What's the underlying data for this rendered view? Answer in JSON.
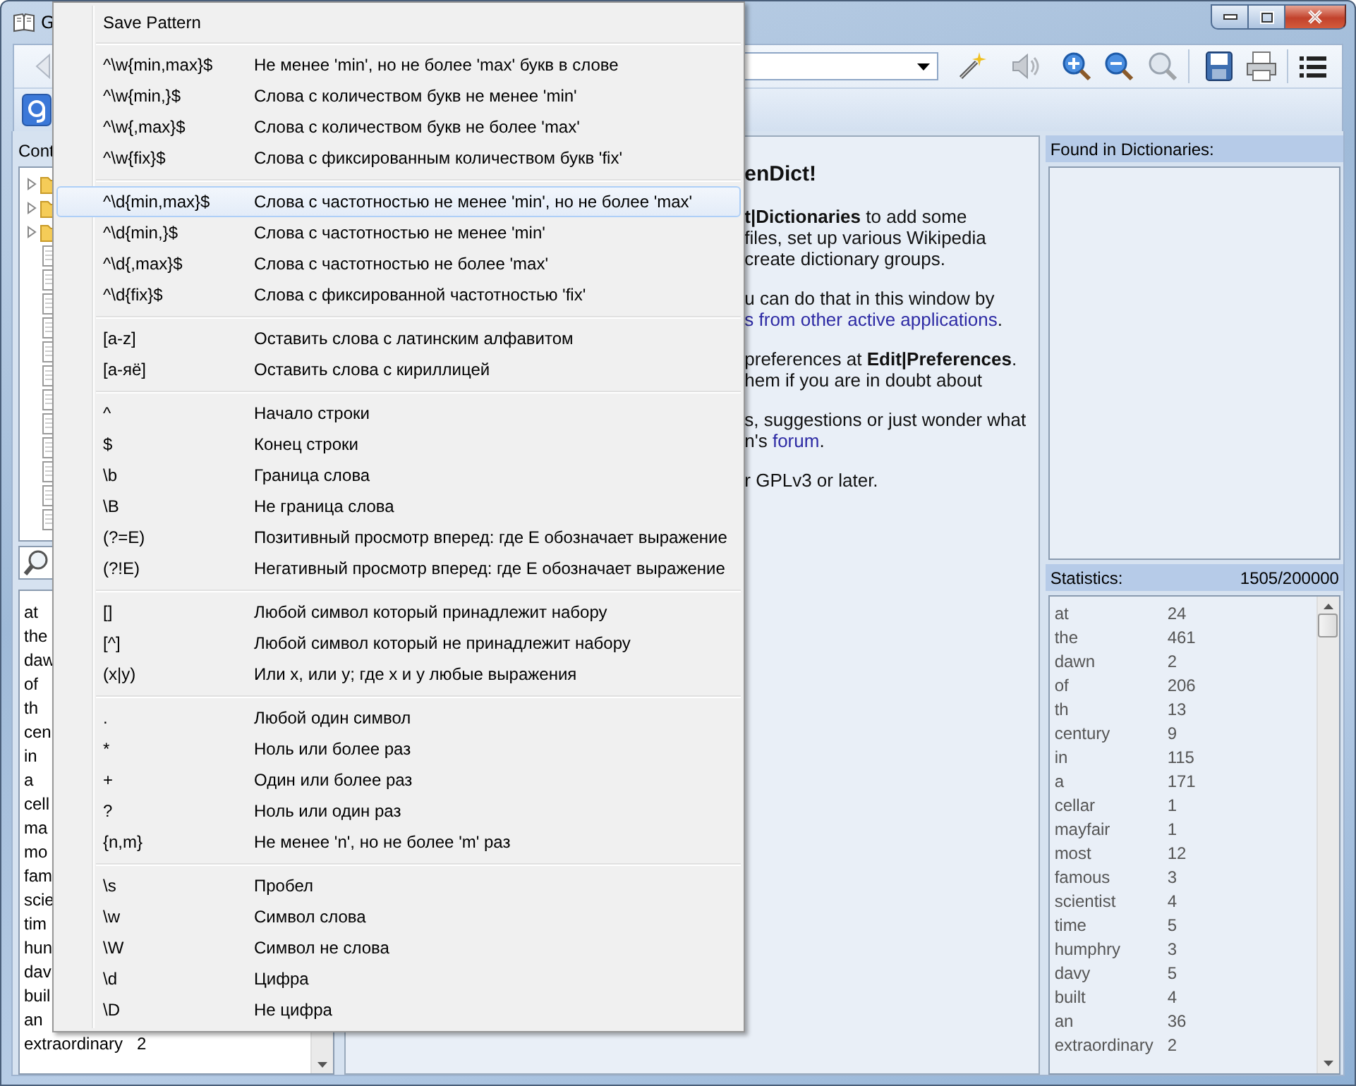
{
  "window": {
    "title": "G"
  },
  "left_panel": {
    "header": "Cont",
    "tree": [
      {
        "kind": "folder",
        "expanded": false
      },
      {
        "kind": "folder",
        "expanded": false
      },
      {
        "kind": "folder",
        "expanded": false
      },
      {
        "kind": "page"
      },
      {
        "kind": "page"
      },
      {
        "kind": "page"
      },
      {
        "kind": "page"
      },
      {
        "kind": "page"
      },
      {
        "kind": "page"
      },
      {
        "kind": "page"
      },
      {
        "kind": "page"
      },
      {
        "kind": "page"
      },
      {
        "kind": "page"
      },
      {
        "kind": "page"
      },
      {
        "kind": "page"
      }
    ],
    "words": [
      {
        "word": "at"
      },
      {
        "word": "the"
      },
      {
        "word": "daw"
      },
      {
        "word": "of"
      },
      {
        "word": "th"
      },
      {
        "word": "cen"
      },
      {
        "word": "in"
      },
      {
        "word": "a"
      },
      {
        "word": "cell"
      },
      {
        "word": "ma"
      },
      {
        "word": "mo"
      },
      {
        "word": "fam"
      },
      {
        "word": "scie"
      },
      {
        "word": "tim"
      },
      {
        "word": "hun"
      },
      {
        "word": "dav"
      },
      {
        "word": "buil"
      },
      {
        "word": "an"
      },
      {
        "word": "extraordinary",
        "count": "2"
      }
    ]
  },
  "article": {
    "heading": "enDict!",
    "paragraphs": [
      [
        [
          {
            "kind": "bold",
            "text": "t|Dictionaries"
          },
          {
            "kind": "plain",
            "text": " to add some"
          }
        ],
        [
          {
            "kind": "plain",
            "text": "files, set up various Wikipedia"
          }
        ],
        [
          {
            "kind": "plain",
            "text": "create dictionary groups."
          }
        ]
      ],
      [
        [
          {
            "kind": "plain",
            "text": "u can do that in this window by"
          }
        ],
        [
          {
            "kind": "link",
            "text": "s from other active applications"
          },
          {
            "kind": "plain",
            "text": "."
          }
        ]
      ],
      [
        [
          {
            "kind": "plain",
            "text": "preferences at "
          },
          {
            "kind": "bold",
            "text": "Edit|Preferences"
          },
          {
            "kind": "plain",
            "text": "."
          }
        ],
        [
          {
            "kind": "plain",
            "text": "hem if you are in doubt about"
          }
        ]
      ],
      [
        [
          {
            "kind": "plain",
            "text": "s, suggestions or just wonder what"
          }
        ],
        [
          {
            "kind": "plain",
            "text": "n's "
          },
          {
            "kind": "link",
            "text": "forum"
          },
          {
            "kind": "plain",
            "text": "."
          }
        ]
      ],
      [
        [
          {
            "kind": "plain",
            "text": "r GPLv3 or later."
          }
        ]
      ]
    ]
  },
  "right_panel": {
    "found_header": "Found in Dictionaries:",
    "stats_header": "Statistics:",
    "stats_total": "1505/200000",
    "stats": [
      {
        "word": "at",
        "count": "24"
      },
      {
        "word": "the",
        "count": "461"
      },
      {
        "word": "dawn",
        "count": "2"
      },
      {
        "word": "of",
        "count": "206"
      },
      {
        "word": "th",
        "count": "13"
      },
      {
        "word": "century",
        "count": "9"
      },
      {
        "word": "in",
        "count": "115"
      },
      {
        "word": "a",
        "count": "171"
      },
      {
        "word": "cellar",
        "count": "1"
      },
      {
        "word": "mayfair",
        "count": "1"
      },
      {
        "word": "most",
        "count": "12"
      },
      {
        "word": "famous",
        "count": "3"
      },
      {
        "word": "scientist",
        "count": "4"
      },
      {
        "word": "time",
        "count": "5"
      },
      {
        "word": "humphry",
        "count": "3"
      },
      {
        "word": "davy",
        "count": "5"
      },
      {
        "word": "built",
        "count": "4"
      },
      {
        "word": "an",
        "count": "36"
      },
      {
        "word": "extraordinary",
        "count": "2"
      }
    ]
  },
  "menu": {
    "items": [
      {
        "kind": "action",
        "label": "Save Pattern"
      },
      {
        "kind": "separator"
      },
      {
        "kind": "pattern",
        "pattern": "^\\w{min,max}$",
        "description": "Не менее 'min', но не более 'max' букв в слове",
        "selected": false
      },
      {
        "kind": "pattern",
        "pattern": "^\\w{min,}$",
        "description": "Слова с количеством букв не менее 'min'",
        "selected": false
      },
      {
        "kind": "pattern",
        "pattern": "^\\w{,max}$",
        "description": "Слова с количеством букв не более 'max'",
        "selected": false
      },
      {
        "kind": "pattern",
        "pattern": "^\\w{fix}$",
        "description": "Слова с фиксированным количеством букв 'fix'",
        "selected": false
      },
      {
        "kind": "separator"
      },
      {
        "kind": "pattern",
        "pattern": "^\\d{min,max}$",
        "description": "Слова с частотностью не менее 'min', но не более 'max'",
        "selected": true
      },
      {
        "kind": "pattern",
        "pattern": "^\\d{min,}$",
        "description": "Слова с частотностью не менее 'min'",
        "selected": false
      },
      {
        "kind": "pattern",
        "pattern": "^\\d{,max}$",
        "description": "Слова с частотностью не более 'max'",
        "selected": false
      },
      {
        "kind": "pattern",
        "pattern": "^\\d{fix}$",
        "description": "Слова с фиксированной частотностью 'fix'",
        "selected": false
      },
      {
        "kind": "separator"
      },
      {
        "kind": "pattern",
        "pattern": "[a-z]",
        "description": "Оставить слова с латинским алфавитом",
        "selected": false
      },
      {
        "kind": "pattern",
        "pattern": "[a-яё]",
        "description": "Оставить слова с кириллицей",
        "selected": false
      },
      {
        "kind": "separator"
      },
      {
        "kind": "pattern",
        "pattern": "^",
        "description": "Начало строки",
        "selected": false
      },
      {
        "kind": "pattern",
        "pattern": "$",
        "description": "Конец строки",
        "selected": false
      },
      {
        "kind": "pattern",
        "pattern": "\\b",
        "description": "Граница слова",
        "selected": false
      },
      {
        "kind": "pattern",
        "pattern": "\\B",
        "description": "Не граница слова",
        "selected": false
      },
      {
        "kind": "pattern",
        "pattern": "(?=E)",
        "description": "Позитивный просмотр вперед: где E обозначает выражение",
        "selected": false
      },
      {
        "kind": "pattern",
        "pattern": "(?!E)",
        "description": "Негативный просмотр вперед: где E обозначает выражение",
        "selected": false
      },
      {
        "kind": "separator"
      },
      {
        "kind": "pattern",
        "pattern": "[]",
        "description": "Любой символ который принадлежит набору",
        "selected": false
      },
      {
        "kind": "pattern",
        "pattern": "[^]",
        "description": "Любой символ который не принадлежит набору",
        "selected": false
      },
      {
        "kind": "pattern",
        "pattern": "(x|y)",
        "description": "Или x, или y; где x и y  любые выражения",
        "selected": false
      },
      {
        "kind": "separator"
      },
      {
        "kind": "pattern",
        "pattern": ".",
        "description": "Любой один символ",
        "selected": false
      },
      {
        "kind": "pattern",
        "pattern": "*",
        "description": "Ноль или более раз",
        "selected": false
      },
      {
        "kind": "pattern",
        "pattern": "+",
        "description": "Один или более раз",
        "selected": false
      },
      {
        "kind": "pattern",
        "pattern": "?",
        "description": "Ноль или один раз",
        "selected": false
      },
      {
        "kind": "pattern",
        "pattern": "{n,m}",
        "description": "Не менее 'n', но не более 'm' раз",
        "selected": false
      },
      {
        "kind": "separator"
      },
      {
        "kind": "pattern",
        "pattern": "\\s",
        "description": "Пробел",
        "selected": false
      },
      {
        "kind": "pattern",
        "pattern": "\\w",
        "description": "Символ слова",
        "selected": false
      },
      {
        "kind": "pattern",
        "pattern": "\\W",
        "description": "Символ не слова",
        "selected": false
      },
      {
        "kind": "pattern",
        "pattern": "\\d",
        "description": "Цифра",
        "selected": false
      },
      {
        "kind": "pattern",
        "pattern": "\\D",
        "description": "Не цифра",
        "selected": false
      }
    ]
  }
}
